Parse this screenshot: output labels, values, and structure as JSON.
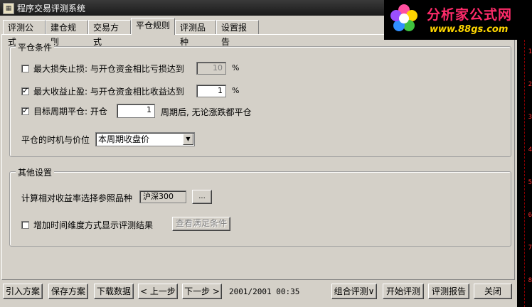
{
  "window": {
    "title": "程序交易评测系统"
  },
  "tabs": [
    {
      "label": "评测公式"
    },
    {
      "label": "建仓规则"
    },
    {
      "label": "交易方式"
    },
    {
      "label": "平仓规则"
    },
    {
      "label": "评测品种"
    },
    {
      "label": "设置报告"
    }
  ],
  "active_tab": "平仓规则",
  "close_conditions": {
    "legend": "平仓条件",
    "max_loss": {
      "label": "最大损失止损: 与开仓资金相比亏损达到",
      "checked": false,
      "value": "10",
      "unit": "%"
    },
    "max_profit": {
      "label": "最大收益止盈: 与开仓资金相比收益达到",
      "checked": true,
      "value": "1",
      "unit": "%"
    },
    "target_period": {
      "label": "目标周期平仓: 开仓",
      "checked": true,
      "value": "1",
      "suffix": "周期后, 无论涨跌都平仓"
    },
    "timing": {
      "label": "平仓的时机与价位",
      "selected": "本周期收盘价"
    }
  },
  "other_settings": {
    "legend": "其他设置",
    "reference_label": "计算相对收益率选择参照品种",
    "reference_value": "沪深300",
    "browse_label": "...",
    "time_dim": {
      "label": "增加时间维度方式显示评测结果",
      "checked": false
    },
    "view_conditions_label": "查看满足条件"
  },
  "bottom_bar": {
    "import_label": "引入方案",
    "save_label": "保存方案",
    "download_label": "下载数据",
    "prev_label": "< 上一步",
    "next_label": "下一步 >",
    "date_range": "2001/2001 00:35",
    "combo_label": "组合评测∨",
    "start_label": "开始评测",
    "report_label": "评测报告",
    "close_label": "关闭"
  },
  "logo": {
    "brand": "分析家公式网",
    "url": "www.88gs.com"
  },
  "side_ticks": [
    "1",
    "2",
    "3",
    "4",
    "5",
    "6",
    "7",
    "8"
  ]
}
